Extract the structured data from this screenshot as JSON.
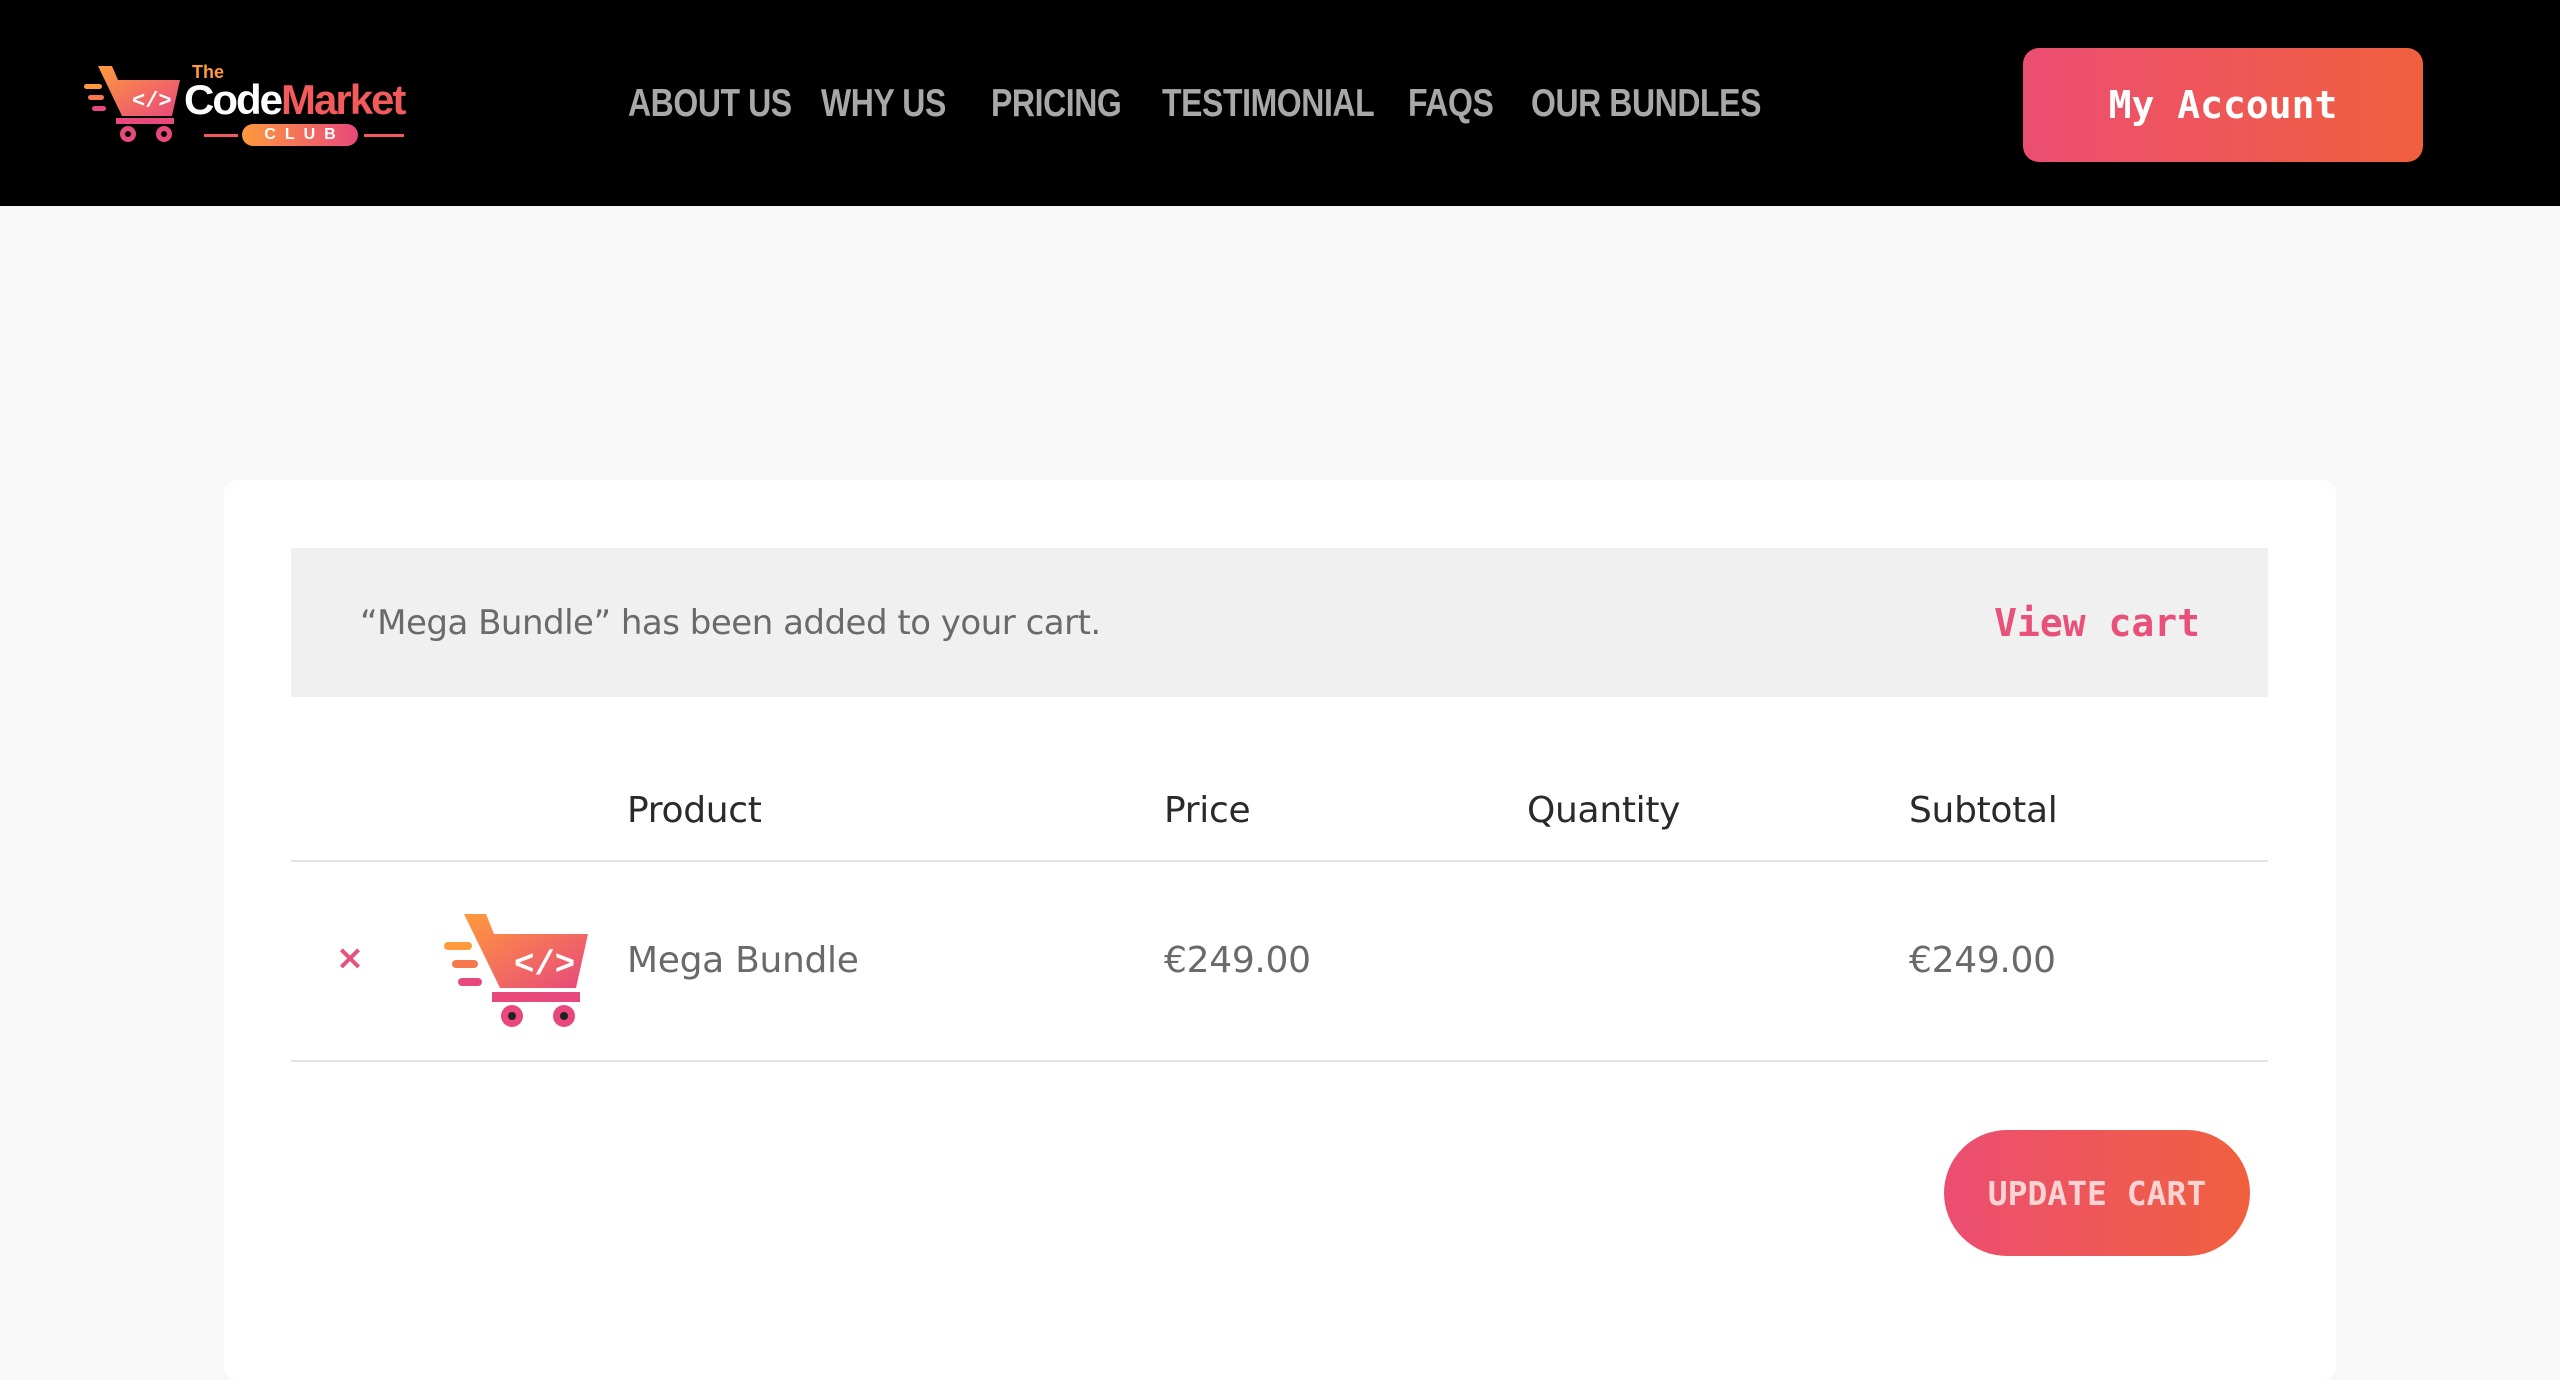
{
  "brand": {
    "logo_the": "The",
    "logo_code": "Code",
    "logo_market": "Market",
    "logo_club": "CLUB"
  },
  "nav": {
    "items": [
      {
        "label": "ABOUT US"
      },
      {
        "label": "WHY US"
      },
      {
        "label": "PRICING"
      },
      {
        "label": "TESTIMONIAL"
      },
      {
        "label": "FAQS"
      },
      {
        "label": "OUR BUNDLES"
      }
    ],
    "account_label": "My Account"
  },
  "notice": {
    "message": "“Mega Bundle” has been added to your cart.",
    "link_label": "View cart"
  },
  "cart": {
    "columns": {
      "product": "Product",
      "price": "Price",
      "quantity": "Quantity",
      "subtotal": "Subtotal"
    },
    "rows": [
      {
        "remove_symbol": "×",
        "thumbnail_icon": "cart-code-icon",
        "name": "Mega Bundle",
        "price": "€249.00",
        "subtotal": "€249.00"
      }
    ],
    "update_label": "UPDATE CART"
  },
  "colors": {
    "header_bg": "#000000",
    "accent_start": "#ec4e72",
    "accent_end": "#f0603e",
    "link": "#e8527a",
    "nav_text": "#a8a8a8",
    "page_bg": "#f8f8f8"
  }
}
